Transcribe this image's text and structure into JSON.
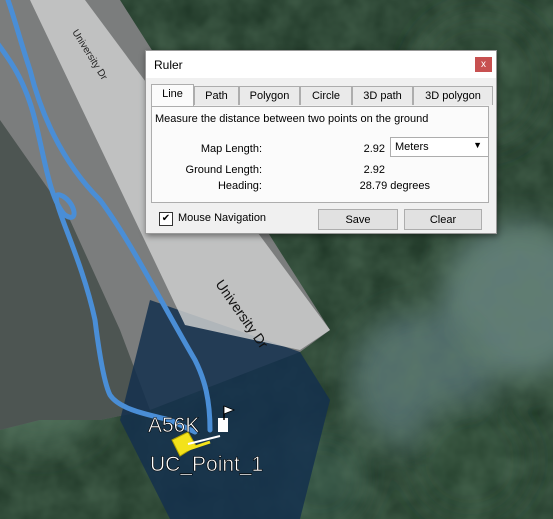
{
  "map": {
    "road_labels": [
      "University Dr",
      "University Dr"
    ],
    "placemarks": [
      {
        "label": "A56K",
        "icon": "flag-icon"
      },
      {
        "label": "UC_Point_1",
        "icon": "pushpin-icon"
      }
    ],
    "colors": {
      "path": "#4a90d9",
      "pin": "#f3e21a",
      "road": "#d9d9d9"
    }
  },
  "ruler": {
    "title": "Ruler",
    "close_label": "x",
    "tabs": [
      "Line",
      "Path",
      "Polygon",
      "Circle",
      "3D path",
      "3D polygon"
    ],
    "active_tab": "Line",
    "description": "Measure the distance between two points on the ground",
    "map_length_label": "Map Length:",
    "map_length_value": "2.92",
    "unit": "Meters",
    "ground_length_label": "Ground Length:",
    "ground_length_value": "2.92",
    "heading_label": "Heading:",
    "heading_value": "28.79 degrees",
    "mouse_nav_label": "Mouse Navigation",
    "mouse_nav_checked": true,
    "save_label": "Save",
    "clear_label": "Clear"
  }
}
